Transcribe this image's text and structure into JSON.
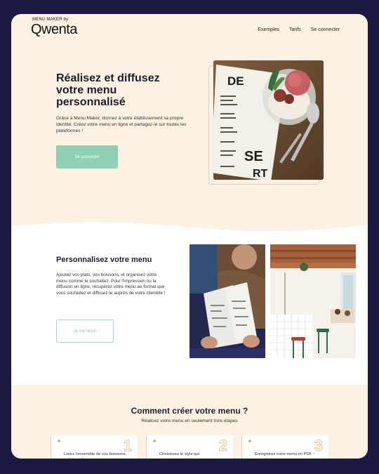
{
  "header": {
    "logo_top": "MENU MAKER by",
    "logo_main": "Qwenta",
    "nav": [
      "Exemples",
      "Tarifs",
      "Se connecter"
    ]
  },
  "hero": {
    "title": "Réalisez et diffusez votre menu personnalisé",
    "text": "Grâce à Menu Maker, donnez à votre établissement sa propre identité. Créez votre menu en ligne et partagez-le sur toutes les plateformes !",
    "button": "Se connecter",
    "image_menu_letters": [
      "DE",
      "SE",
      "RT"
    ]
  },
  "section2": {
    "title": "Personnalisez votre menu",
    "text": "Ajoutez vos plats, vos boissons, et organisez votre menu comme le souhaitez. Pour l'impression ou la diffusion en ligne, récupérez votre menu au format que vous souhaitez et diffusez-le auprès de votre clientèle !",
    "button": "Je me lance"
  },
  "section3": {
    "title": "Comment créer votre menu ?",
    "subtitle": "Réalisez votre menu en seulement trois étapes",
    "steps": [
      {
        "number": "1",
        "text": "Listez l'ensemble de vos boissons, entrées, plats"
      },
      {
        "number": "2",
        "text": "Choisissez le style qui"
      },
      {
        "number": "3",
        "text": "Enregistrez votre menu en PDF"
      }
    ]
  },
  "colors": {
    "background": "#1b1a44",
    "cream": "#fdf1e4",
    "mint": "#8fd0b6",
    "text": "#1d1d2b"
  }
}
